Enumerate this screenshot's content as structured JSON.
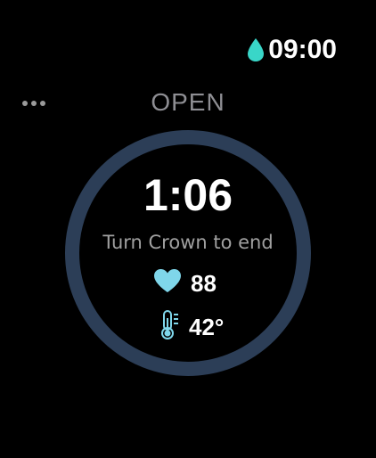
{
  "status_bar": {
    "time": "09:00",
    "drop_color": "#39d6c8"
  },
  "header": {
    "mode_label": "OPEN",
    "more_icon": "ellipsis-icon"
  },
  "session": {
    "timer": "1:06",
    "hint": "Turn Crown to end",
    "heart_rate": "88",
    "temperature": "42°",
    "ring_color": "#2c3e57",
    "accent_color": "#7fd6ea"
  }
}
